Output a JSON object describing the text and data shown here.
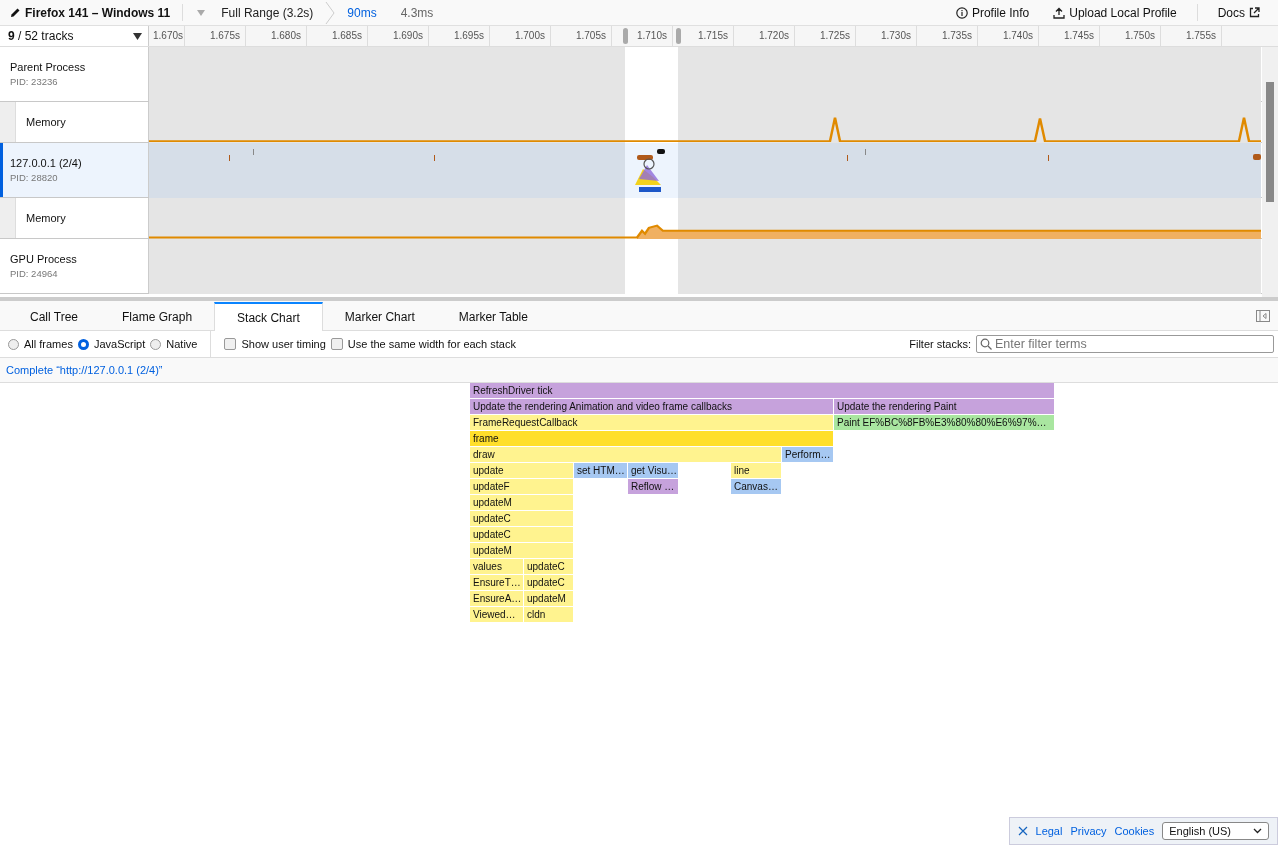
{
  "top_bar": {
    "title": "Firefox 141 – Windows 11",
    "breadcrumbs": [
      {
        "label": "Full Range (3.2s)",
        "kind": "range",
        "selected": false
      },
      {
        "label": "90ms",
        "kind": "range",
        "selected": true
      },
      {
        "label": "4.3ms",
        "kind": "preview",
        "selected": false
      }
    ],
    "actions": [
      {
        "label": "Profile Info"
      },
      {
        "label": "Upload Local Profile"
      },
      {
        "label": "Docs"
      }
    ]
  },
  "timeline": {
    "track_count": "**9** / 52 tracks",
    "ticks": [
      "1.670s",
      "1.675s",
      "1.680s",
      "1.685s",
      "1.690s",
      "1.695s",
      "1.700s",
      "1.705s",
      "1.710s",
      "1.715s",
      "1.720s",
      "1.725s",
      "1.730s",
      "1.735s",
      "1.740s",
      "1.745s",
      "1.750s",
      "1.755s"
    ],
    "tracks": [
      {
        "kind": "process",
        "name": "Parent Process",
        "pid": "PID: 23236",
        "selected": false
      },
      {
        "kind": "memory",
        "name": "Memory",
        "selected": false
      },
      {
        "kind": "process",
        "name": "127.0.0.1 (2/4)",
        "pid": "PID: 28820",
        "selected": true
      },
      {
        "kind": "memory",
        "name": "Memory",
        "selected": false
      },
      {
        "kind": "process",
        "name": "GPU Process",
        "pid": "PID: 24964",
        "selected": false
      }
    ]
  },
  "tabs": [
    {
      "label": "Call Tree",
      "selected": false
    },
    {
      "label": "Flame Graph",
      "selected": false
    },
    {
      "label": "Stack Chart",
      "selected": true
    },
    {
      "label": "Marker Chart",
      "selected": false
    },
    {
      "label": "Marker Table",
      "selected": false
    }
  ],
  "options": {
    "radios": [
      {
        "label": "All frames",
        "selected": false
      },
      {
        "label": "JavaScript",
        "selected": true
      },
      {
        "label": "Native",
        "selected": false
      }
    ],
    "checkboxes": [
      {
        "label": "Show user timing",
        "checked": false
      },
      {
        "label": "Use the same width for each stack",
        "checked": false
      }
    ],
    "filter_label": "Filter stacks:",
    "filter_placeholder": "Enter filter terms"
  },
  "breadcrumb": "Complete “http://127.0.0.1 (2/4)”",
  "stack_chart": [
    [
      {
        "label": "RefreshDriver tick",
        "kind": "label",
        "selected": false
      }
    ],
    [
      {
        "label": "Update the rendering Animation and video frame callbacks",
        "kind": "label",
        "selected": false
      },
      {
        "label": "Update the rendering Paint",
        "kind": "label",
        "selected": false
      }
    ],
    [
      {
        "label": "FrameRequestCallback",
        "kind": "js",
        "selected": false
      },
      {
        "label": "Paint EF%BC%8FB%E3%80%80%E6%97%…",
        "kind": "graphics",
        "selected": false
      }
    ],
    [
      {
        "label": "frame",
        "kind": "js",
        "selected": true
      }
    ],
    [
      {
        "label": "draw",
        "kind": "js",
        "selected": false
      },
      {
        "label": "Perform…",
        "kind": "dom",
        "selected": false
      }
    ],
    [
      {
        "label": "update",
        "kind": "js",
        "selected": false
      },
      {
        "label": "set HTM…",
        "kind": "dom",
        "selected": false
      },
      {
        "label": "get Visu…",
        "kind": "dom",
        "selected": false
      },
      {
        "label": "line",
        "kind": "js",
        "selected": false
      }
    ],
    [
      {
        "label": "updateF",
        "kind": "js",
        "selected": false
      },
      {
        "label": "Reflow …",
        "kind": "label",
        "selected": false
      },
      {
        "label": "Canvas…",
        "kind": "dom",
        "selected": false
      }
    ],
    [
      {
        "label": "updateM",
        "kind": "js",
        "selected": false
      }
    ],
    [
      {
        "label": "updateC",
        "kind": "js",
        "selected": false
      }
    ],
    [
      {
        "label": "updateC",
        "kind": "js",
        "selected": false
      }
    ],
    [
      {
        "label": "updateM",
        "kind": "js",
        "selected": false
      }
    ],
    [
      {
        "label": "values",
        "kind": "js",
        "selected": false
      },
      {
        "label": "updateC",
        "kind": "js",
        "selected": false
      }
    ],
    [
      {
        "label": "EnsureT…",
        "kind": "js",
        "selected": false
      },
      {
        "label": "updateC",
        "kind": "js",
        "selected": false
      }
    ],
    [
      {
        "label": "EnsureA…",
        "kind": "js",
        "selected": false
      },
      {
        "label": "updateM",
        "kind": "js",
        "selected": false
      }
    ],
    [
      {
        "label": "Viewed…",
        "kind": "js",
        "selected": false
      },
      {
        "label": "cldn",
        "kind": "js",
        "selected": false
      }
    ]
  ],
  "footer": {
    "links": [
      "Legal",
      "Privacy",
      "Cookies"
    ],
    "language": "English (US)"
  }
}
